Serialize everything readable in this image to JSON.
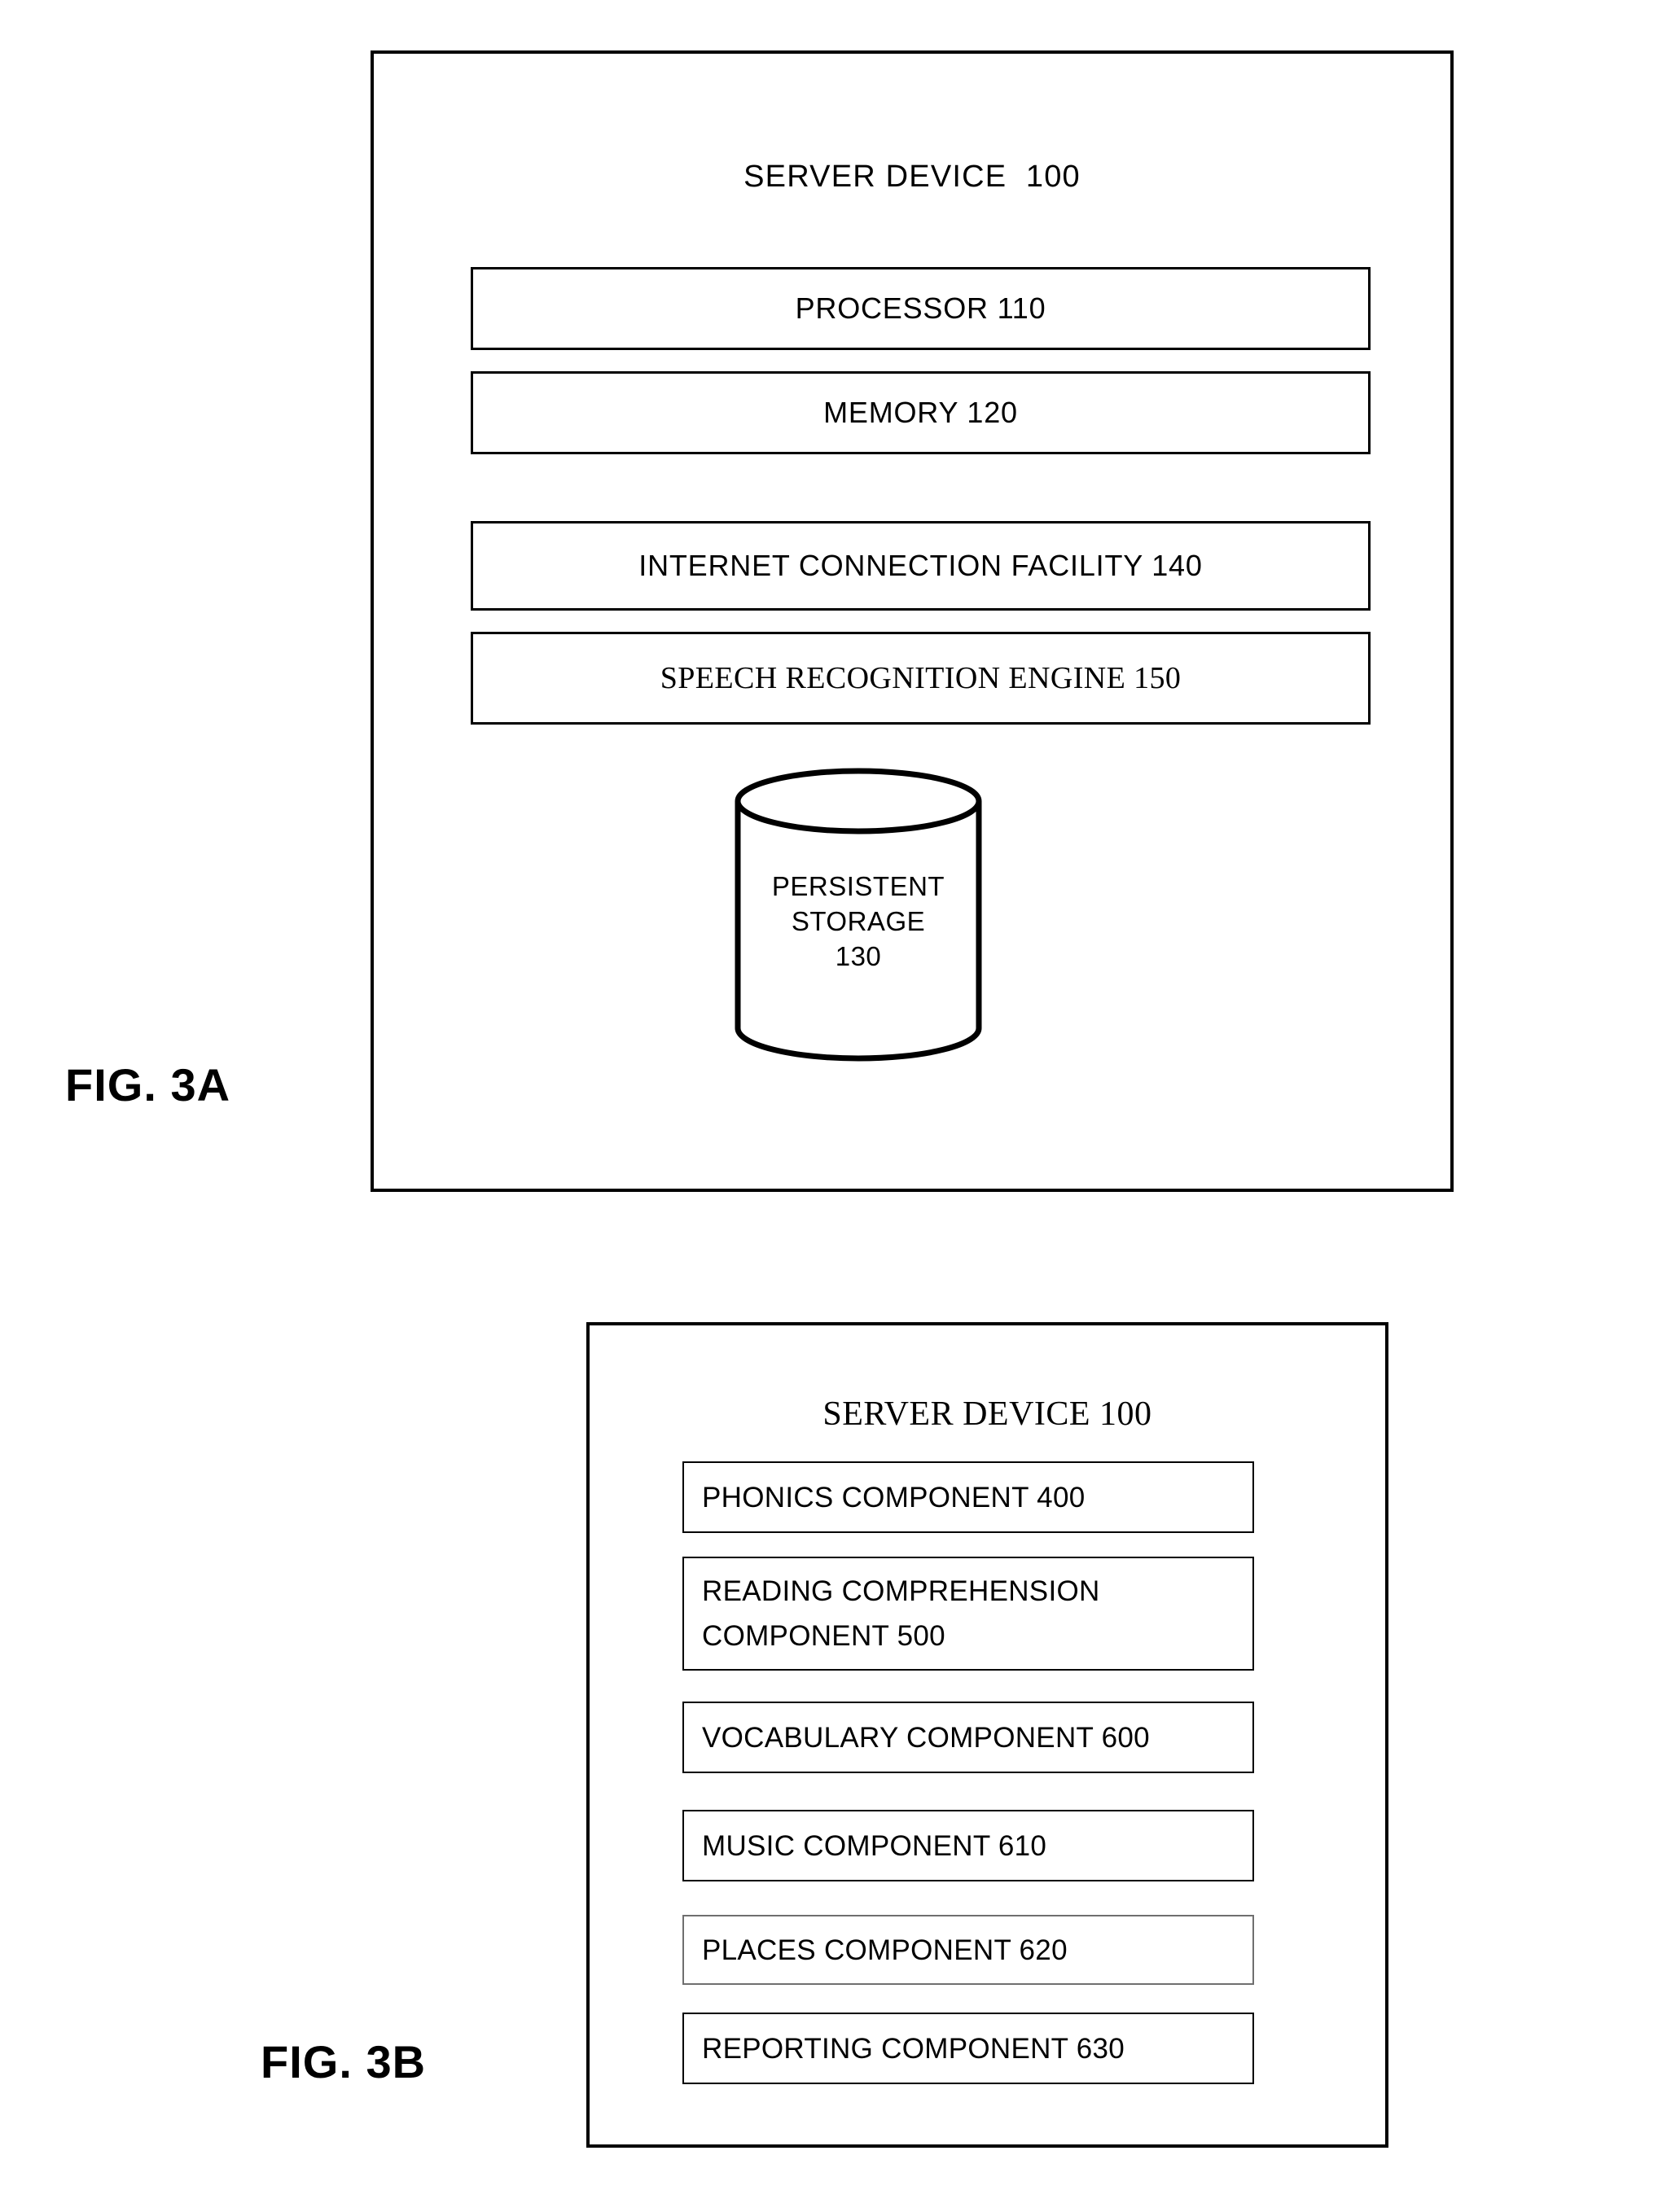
{
  "figures": [
    {
      "caption": "FIG. 3A",
      "title": "SERVER DEVICE  100",
      "components": [
        {
          "label": "PROCESSOR 110",
          "font": "sans"
        },
        {
          "label": "MEMORY 120",
          "font": "sans"
        },
        {
          "label": "INTERNET CONNECTION FACILITY 140",
          "font": "sans"
        },
        {
          "label": "SPEECH RECOGNITION ENGINE 150",
          "font": "serif"
        }
      ],
      "storage": {
        "shape": "cylinder",
        "lines": [
          "PERSISTENT",
          "STORAGE",
          "130"
        ]
      }
    },
    {
      "caption": "FIG. 3B",
      "title": "SERVER DEVICE 100",
      "components": [
        {
          "lines": [
            "PHONICS COMPONENT 400"
          ]
        },
        {
          "lines": [
            "READING COMPREHENSION",
            "COMPONENT 500"
          ]
        },
        {
          "lines": [
            "VOCABULARY COMPONENT 600"
          ]
        },
        {
          "lines": [
            "MUSIC COMPONENT 610"
          ]
        },
        {
          "lines": [
            "PLACES COMPONENT 620"
          ]
        },
        {
          "lines": [
            "REPORTING COMPONENT 630"
          ]
        }
      ]
    }
  ],
  "colors": {
    "ink": "#000000",
    "paper": "#ffffff",
    "light_border": "#6f6f6f"
  }
}
